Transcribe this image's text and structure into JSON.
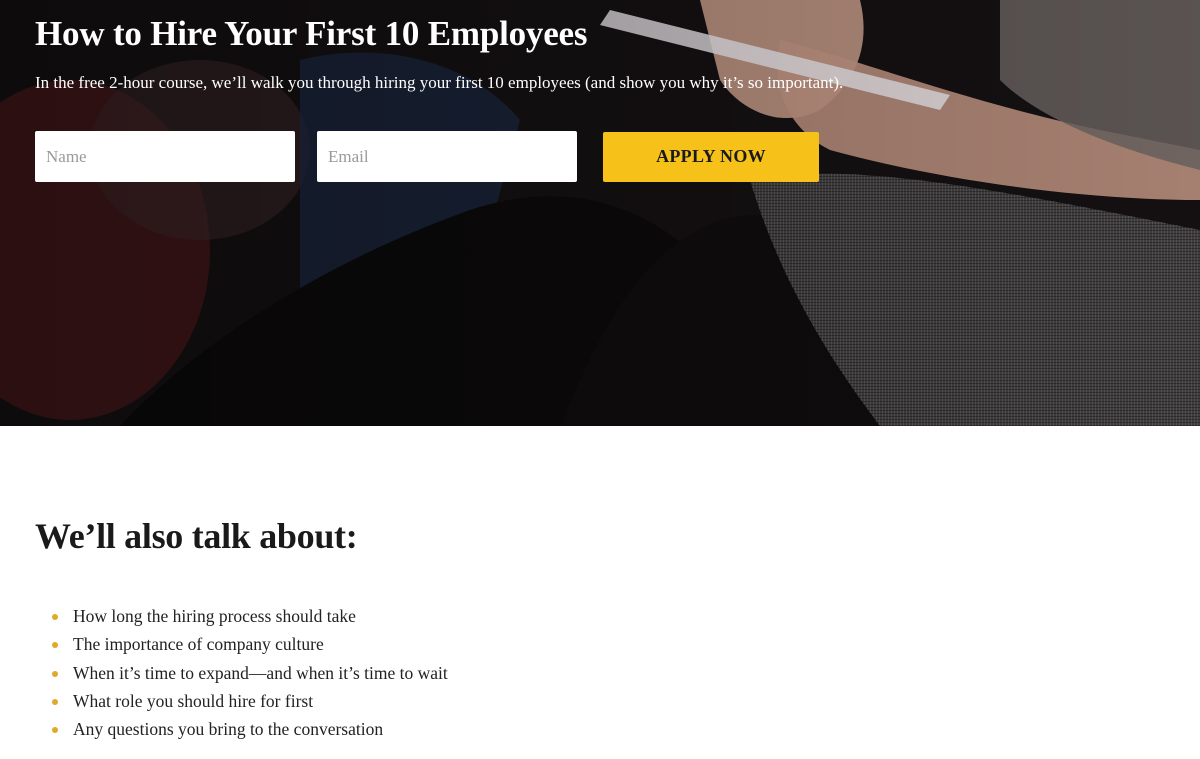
{
  "hero": {
    "title": "How to Hire Your First 10 Employees",
    "subtitle": "In the free 2-hour course, we’ll walk you through hiring your first 10 employees (and show you why it’s so important).",
    "form": {
      "name_placeholder": "Name",
      "email_placeholder": "Email",
      "submit_label": "APPLY NOW"
    },
    "background_image": "person-taking-notes-photo"
  },
  "topics": {
    "title": "We’ll also talk about:",
    "items": [
      "How long the hiring process should take",
      "The importance of company culture",
      "When it’s time to expand—and when it’s time to wait",
      "What role you should hire for first",
      "Any questions you bring to the conversation"
    ]
  },
  "colors": {
    "accent": "#f6c21a",
    "bullet": "#e0a92a",
    "hero_overlay": "#120f10",
    "text": "#1a1a1a"
  }
}
